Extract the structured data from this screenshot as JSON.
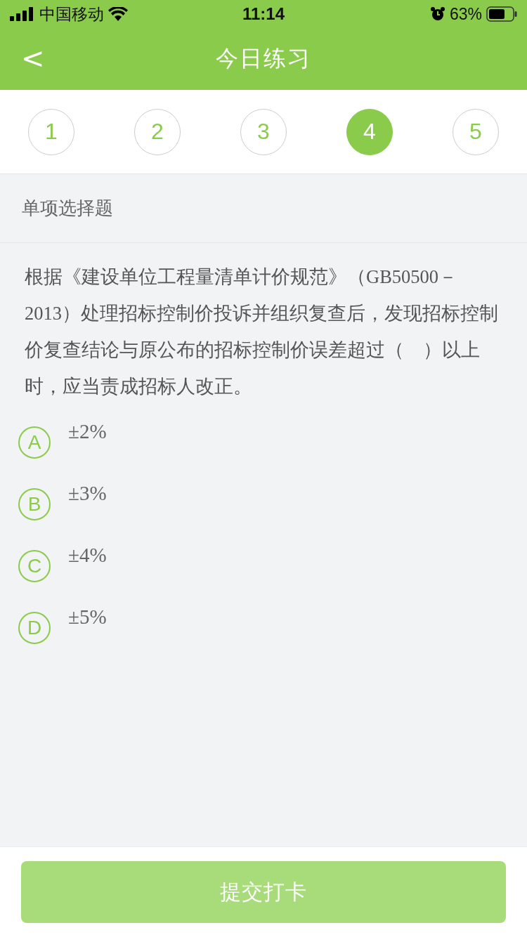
{
  "status_bar": {
    "carrier": "中国移动",
    "time": "11:14",
    "battery": "63%"
  },
  "nav": {
    "back": "<",
    "title": "今日练习"
  },
  "tabs": [
    {
      "label": "1",
      "selected": false
    },
    {
      "label": "2",
      "selected": false
    },
    {
      "label": "3",
      "selected": false
    },
    {
      "label": "4",
      "selected": true
    },
    {
      "label": "5",
      "selected": false
    }
  ],
  "section_title": "单项选择题",
  "question": "根据《建设单位工程量清单计价规范》（GB50500－2013）处理招标控制价投诉并组织复查后，发现招标控制价复查结论与原公布的招标控制价误差超过（　）以上时，应当责成招标人改正。",
  "options": [
    {
      "letter": "A",
      "text": "±2%",
      "selected": false
    },
    {
      "letter": "B",
      "text": "±3%",
      "selected": false
    },
    {
      "letter": "C",
      "text": "±4%",
      "selected": false
    },
    {
      "letter": "D",
      "text": "±5%",
      "selected": false
    }
  ],
  "submit": "提交打卡"
}
